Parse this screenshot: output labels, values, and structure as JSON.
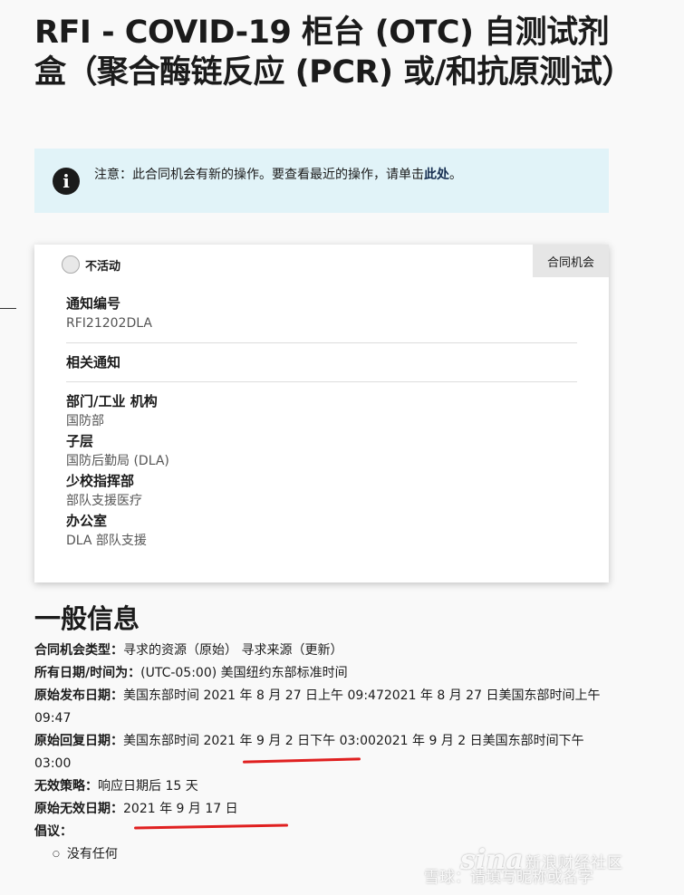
{
  "page": {
    "title": "RFI - COVID-19 柜台 (OTC) 自测试剂盒（聚合酶链反应 (PCR) 或/和抗原测试）"
  },
  "notice": {
    "icon": "info-icon",
    "text_before": "注意：此合同机会有新的操作。要查看最近的操作，请单击",
    "link_text": "此处",
    "text_after": "。"
  },
  "card": {
    "status": "不活动",
    "tab_label": "合同机会",
    "notice_id_label": "通知编号",
    "notice_id_value": "RFI21202DLA",
    "related_label": "相关通知",
    "dept_label": "部门/工业 机构",
    "dept_value": "国防部",
    "subtier_label": "子层",
    "subtier_value": "国防后勤局 (DLA)",
    "command_label": "少校指挥部",
    "command_value": "部队支援医疗",
    "office_label": "办公室",
    "office_value": "DLA 部队支援"
  },
  "general": {
    "title": "一般信息",
    "rows": [
      {
        "label": "合同机会类型：",
        "value": "寻求的资源（原始） 寻求来源（更新）"
      },
      {
        "label": "所有日期/时间为：",
        "value": "(UTC-05:00) 美国纽约东部标准时间"
      },
      {
        "label": "原始发布日期：",
        "value": "美国东部时间 2021 年 8 月 27 日上午 09:472021 年 8 月 27 日美国东部时间上午 09:47"
      },
      {
        "label": "原始回复日期：",
        "value": "美国东部时间 2021 年 9 月 2 日下午 03:002021 年 9 月 2 日美国东部时间下午 03:00"
      },
      {
        "label": "无效策略：",
        "value": "响应日期后 15 天"
      },
      {
        "label": "原始无效日期：",
        "value": "2021 年 9 月 17 日"
      }
    ],
    "proposal_label": "倡议：",
    "proposal_items": [
      "没有任何"
    ]
  },
  "watermark": {
    "logo": "sina",
    "brand": "新浪财经社区",
    "line": "雪球：请填写昵称或名字"
  }
}
